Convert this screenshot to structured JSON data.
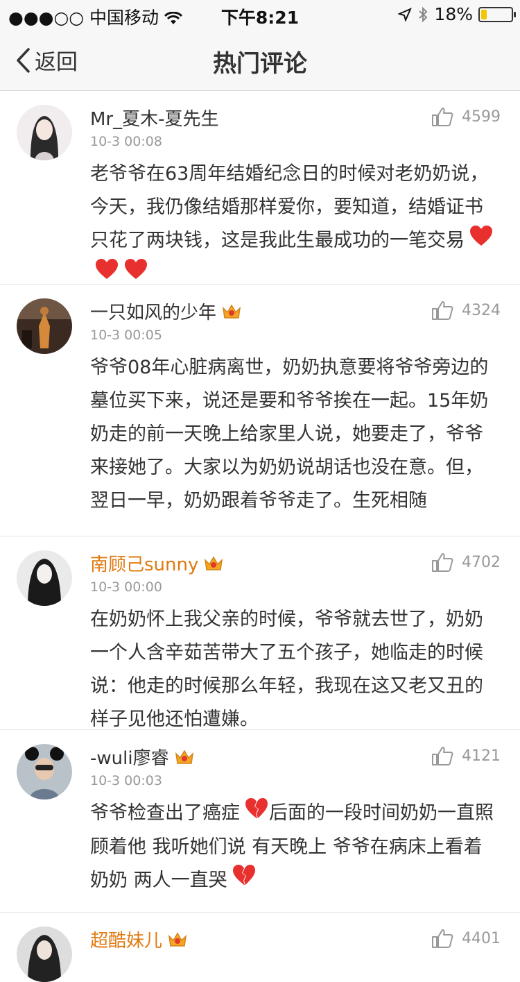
{
  "status_bar": {
    "carrier": "●●●○○ 中国移动",
    "time": "下午8:21",
    "battery": "18%",
    "battery_level": 0.18
  },
  "nav": {
    "back_label": "返回",
    "title": "热门评论"
  },
  "comments": [
    {
      "username": "Mr_夏木-夏先生",
      "time": "10-3 00:08",
      "likes": "4599",
      "text": "老爷爷在63周年结婚纪念日的时候对老奶奶说，今天，我仍像结婚那样爱你，要知道，结婚证书只花了两块钱，这是我此生最成功的一笔交易",
      "emoji": [
        "red-heart",
        "red-heart",
        "red-heart"
      ]
    },
    {
      "username": "一只如风的少年",
      "time": "10-3 00:05",
      "likes": "4324",
      "text": "爷爷08年心脏病离世，奶奶执意要将爷爷旁边的墓位买下来，说还是要和爷爷挨在一起。15年奶奶走的前一天晚上给家里人说，她要走了，爷爷来接她了。大家以为奶奶说胡话也没在意。但，翌日一早，奶奶跟着爷爷走了。生死相随"
    },
    {
      "username": "南顾己sunny",
      "time": "10-3 00:00",
      "likes": "4702",
      "text": "在奶奶怀上我父亲的时候，爷爷就去世了，奶奶一个人含辛茹苦带大了五个孩子，她临走的时候说：他走的时候那么年轻，我现在这又老又丑的样子见他还怕遭嫌。"
    },
    {
      "username": "-wuli廖睿",
      "time": "10-3 00:03",
      "likes": "4121",
      "text_parts": [
        "爷爷检查出了癌症",
        "后面的一段时间奶奶一直照顾着他 我听她们说 有天晚上 爷爷在病床上看着奶奶 两人一直哭"
      ],
      "emoji": [
        "broken-heart",
        "broken-heart"
      ]
    },
    {
      "username": "超酷妹儿",
      "time": "",
      "likes": "4401",
      "text": ""
    }
  ],
  "colors": {
    "vip_name": "#e07a10",
    "heart": "#e8302f"
  }
}
